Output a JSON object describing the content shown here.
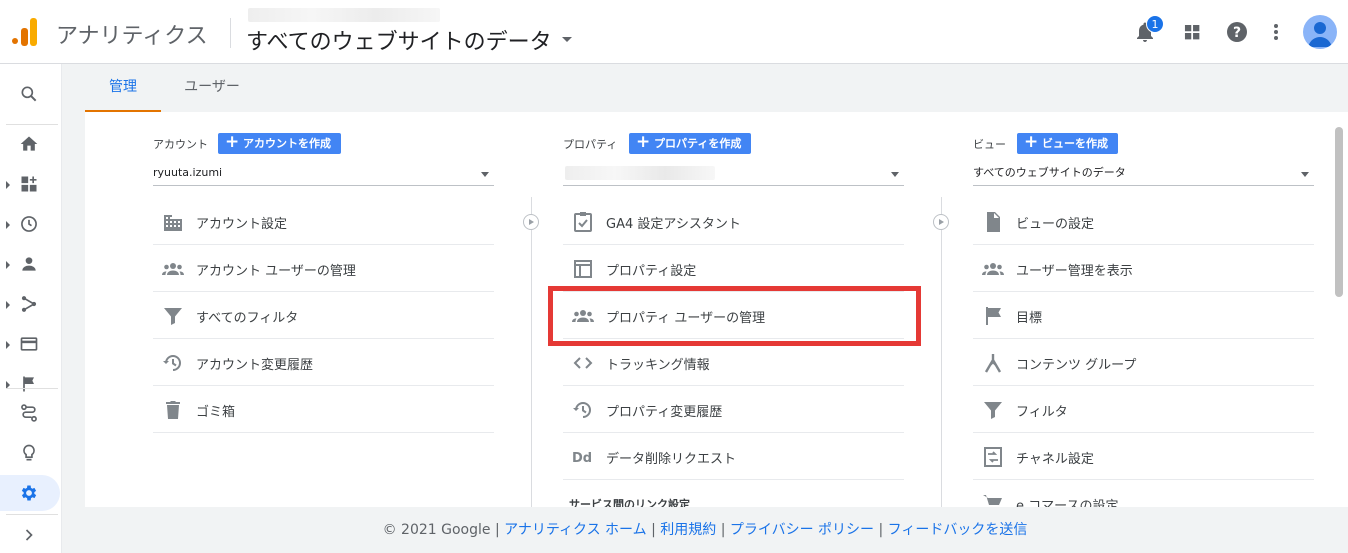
{
  "header": {
    "app_title": "アナリティクス",
    "view_title": "すべてのウェブサイトのデータ",
    "notification_count": "1"
  },
  "tabs": [
    {
      "label": "管理",
      "active": true
    },
    {
      "label": "ユーザー",
      "active": false
    }
  ],
  "columns": {
    "account": {
      "label": "アカウント",
      "create_button": "アカウントを作成",
      "selected": "ryuuta.izumi",
      "items": [
        {
          "label": "アカウント設定",
          "icon": "building-icon"
        },
        {
          "label": "アカウント ユーザーの管理",
          "icon": "users-icon"
        },
        {
          "label": "すべてのフィルタ",
          "icon": "filter-icon"
        },
        {
          "label": "アカウント変更履歴",
          "icon": "history-icon"
        },
        {
          "label": "ゴミ箱",
          "icon": "trash-icon"
        }
      ]
    },
    "property": {
      "label": "プロパティ",
      "create_button": "プロパティを作成",
      "selected": "",
      "items": [
        {
          "label": "GA4 設定アシスタント",
          "icon": "checklist-icon"
        },
        {
          "label": "プロパティ設定",
          "icon": "layout-icon"
        },
        {
          "label": "プロパティ ユーザーの管理",
          "icon": "users-icon",
          "highlighted": true
        },
        {
          "label": "トラッキング情報",
          "icon": "code-icon"
        },
        {
          "label": "プロパティ変更履歴",
          "icon": "history-icon"
        },
        {
          "label": "データ削除リクエスト",
          "icon": "dd-icon",
          "icon_text": "Dd"
        }
      ],
      "section_title": "サービス間のリンク設定"
    },
    "view": {
      "label": "ビュー",
      "create_button": "ビューを作成",
      "selected": "すべてのウェブサイトのデータ",
      "items": [
        {
          "label": "ビューの設定",
          "icon": "document-icon"
        },
        {
          "label": "ユーザー管理を表示",
          "icon": "users-icon"
        },
        {
          "label": "目標",
          "icon": "flag-icon"
        },
        {
          "label": "コンテンツ グループ",
          "icon": "content-group-icon"
        },
        {
          "label": "フィルタ",
          "icon": "filter-icon"
        },
        {
          "label": "チャネル設定",
          "icon": "channel-icon"
        },
        {
          "label": "e コマースの設定",
          "icon": "cart-icon"
        }
      ]
    }
  },
  "footer": {
    "copyright": "© 2021 Google",
    "links": [
      "アナリティクス ホーム",
      "利用規約",
      "プライバシー ポリシー",
      "フィードバックを送信"
    ]
  },
  "colors": {
    "accent": "#1a73e8",
    "button": "#4285f4",
    "highlight": "#e53935",
    "logo_orange": "#e37400",
    "logo_yellow": "#f9ab00"
  }
}
